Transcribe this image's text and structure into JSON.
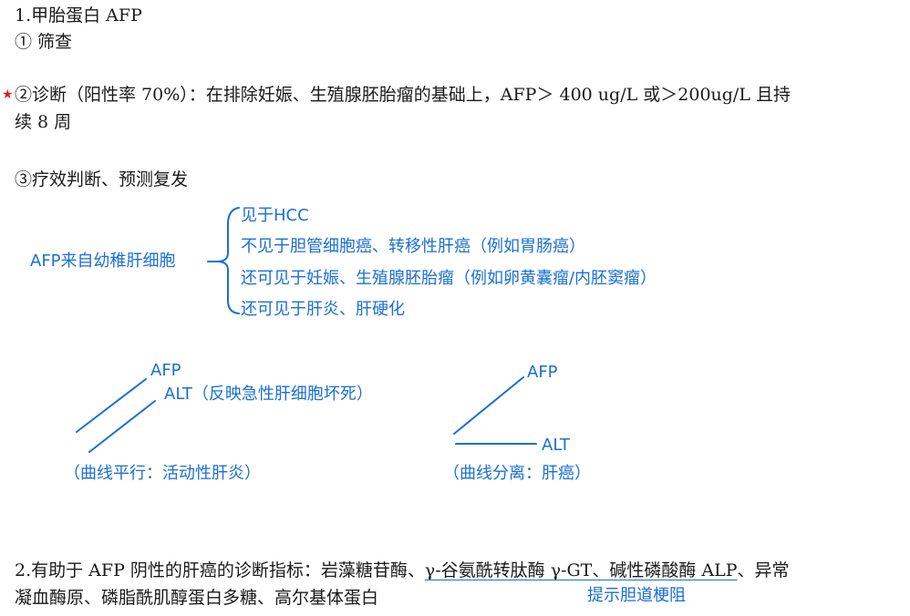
{
  "section1": {
    "title": "1.甲胎蛋白 AFP",
    "item1": "① 筛查",
    "item2_marker": "★",
    "item2_line1": "②诊断（阳性率 70%）：在排除妊娠、生殖腺胚胎瘤的基础上，AFP＞ 400 ug/L 或＞200ug/L 且持",
    "item2_line2": "续 8 周",
    "item3": "③疗效判断、预测复发"
  },
  "notes": {
    "source_label": "AFP来自幼稚肝细胞",
    "branches": [
      "见于HCC",
      "不见于胆管细胞癌、转移性肝癌（例如胃肠癌）",
      "还可见于妊娠、生殖腺胚胎瘤（例如卵黄囊瘤/内胚窦瘤）",
      "还可见于肝炎、肝硬化"
    ]
  },
  "diagram_left": {
    "label_afp": "AFP",
    "label_alt": "ALT（反映急性肝细胞坏死）",
    "caption": "（曲线平行：活动性肝炎）"
  },
  "diagram_right": {
    "label_afp": "AFP",
    "label_alt": "ALT",
    "caption": "（曲线分离：肝癌）"
  },
  "section2": {
    "line1_prefix": "2.有助于 AFP 阴性的肝癌的诊断指标：岩藻糖苷酶、",
    "line1_underlined": "γ-谷氨酰转肽酶 γ-GT、碱性磷酸酶 ALP",
    "line1_suffix": "、异常",
    "line2": "凝血酶原、磷脂酰肌醇蛋白多糖、高尔基体蛋白",
    "annotation": "提示胆道梗阻"
  },
  "colors": {
    "ink_blue": "#1a6fd6",
    "star_red": "#d62020",
    "text": "#1a1a1a"
  }
}
